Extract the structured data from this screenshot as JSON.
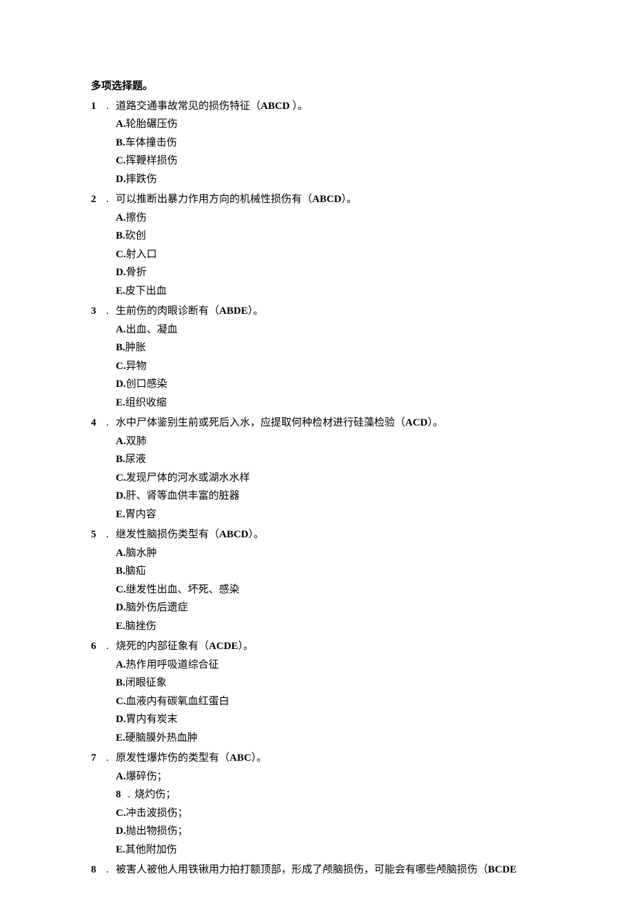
{
  "section_title": "多项选择题。",
  "questions": [
    {
      "num": "1",
      "text_pre": "道路交通事故常见的损伤特征（",
      "answer": "ABCD",
      "text_post": "  ）。",
      "options": [
        {
          "letter": "A.",
          "text": "轮胎碾压伤"
        },
        {
          "letter": "B.",
          "text": "车体撞击伤"
        },
        {
          "letter": "C.",
          "text": "挥鞭样损伤"
        },
        {
          "letter": "D.",
          "text": "摔跌伤"
        }
      ]
    },
    {
      "num": "2",
      "text_pre": "可以推断出暴力作用方向的机械性损伤有（",
      "answer": "ABCD",
      "text_post": "）。",
      "options": [
        {
          "letter": "A.",
          "text": "擦伤"
        },
        {
          "letter": "B.",
          "text": "砍创"
        },
        {
          "letter": "C.",
          "text": "射入口"
        },
        {
          "letter": "D.",
          "text": "骨折"
        },
        {
          "letter": "E.",
          "text": "皮下出血"
        }
      ]
    },
    {
      "num": "3",
      "text_pre": "生前伤的肉眼诊断有（",
      "answer": "ABDE",
      "text_post": "）。",
      "options": [
        {
          "letter": "A.",
          "text": "出血、凝血"
        },
        {
          "letter": "B.",
          "text": "肿胀"
        },
        {
          "letter": "C.",
          "text": "异物"
        },
        {
          "letter": "D.",
          "text": "创口感染"
        },
        {
          "letter": "E.",
          "text": "组织收缩"
        }
      ]
    },
    {
      "num": "4",
      "text_pre": "水中尸体鉴别生前或死后入水，应提取何种检材进行硅藻检验（",
      "answer": "ACD",
      "text_post": "）。",
      "options": [
        {
          "letter": "A.",
          "text": "双肺"
        },
        {
          "letter": "B.",
          "text": "尿液"
        },
        {
          "letter": "C.",
          "text": "发现尸体的河水或湖水水样"
        },
        {
          "letter": "D.",
          "text": "肝、肾等血供丰富的脏器"
        },
        {
          "letter": "E.",
          "text": "胃内容"
        }
      ]
    },
    {
      "num": "5",
      "text_pre": "继发性脑损伤类型有（",
      "answer": "ABCD",
      "text_post": "）。",
      "options": [
        {
          "letter": "A.",
          "text": "脑水肿"
        },
        {
          "letter": "B.",
          "text": "脑疝"
        },
        {
          "letter": "C.",
          "text": "继发性出血、坏死、感染"
        },
        {
          "letter": "D.",
          "text": "脑外伤后遗症"
        },
        {
          "letter": "E.",
          "text": "脑挫伤"
        }
      ]
    },
    {
      "num": "6",
      "text_pre": "烧死的内部征象有（",
      "answer": "ACDE",
      "text_post": "）。",
      "options": [
        {
          "letter": "A.",
          "text": "热作用呼吸道综合征"
        },
        {
          "letter": "B.",
          "text": "闭眼征象"
        },
        {
          "letter": "C.",
          "text": "血液内有碳氧血红蛋白"
        },
        {
          "letter": "D.",
          "text": "胃内有炭末"
        },
        {
          "letter": "E.",
          "text": "硬脑膜外热血肿"
        }
      ]
    },
    {
      "num": "7",
      "text_pre": "原发性爆炸伤的类型有（",
      "answer": "ABC",
      "text_post": "）。",
      "options": [
        {
          "letter": "A.",
          "text": "爆碎伤；"
        },
        {
          "letter": "8",
          "text": "烧灼伤；",
          "numbered": true
        },
        {
          "letter": "C.",
          "text": "冲击波损伤；"
        },
        {
          "letter": "D.",
          "text": "抛出物损伤；"
        },
        {
          "letter": "E.",
          "text": "其他附加伤"
        }
      ]
    },
    {
      "num": "8",
      "text_pre": "被害人被他人用铁锹用力拍打额顶部，形成了颅脑损伤，可能会有哪些颅脑损伤（",
      "answer": "BCDE",
      "text_post": "",
      "options": []
    }
  ]
}
